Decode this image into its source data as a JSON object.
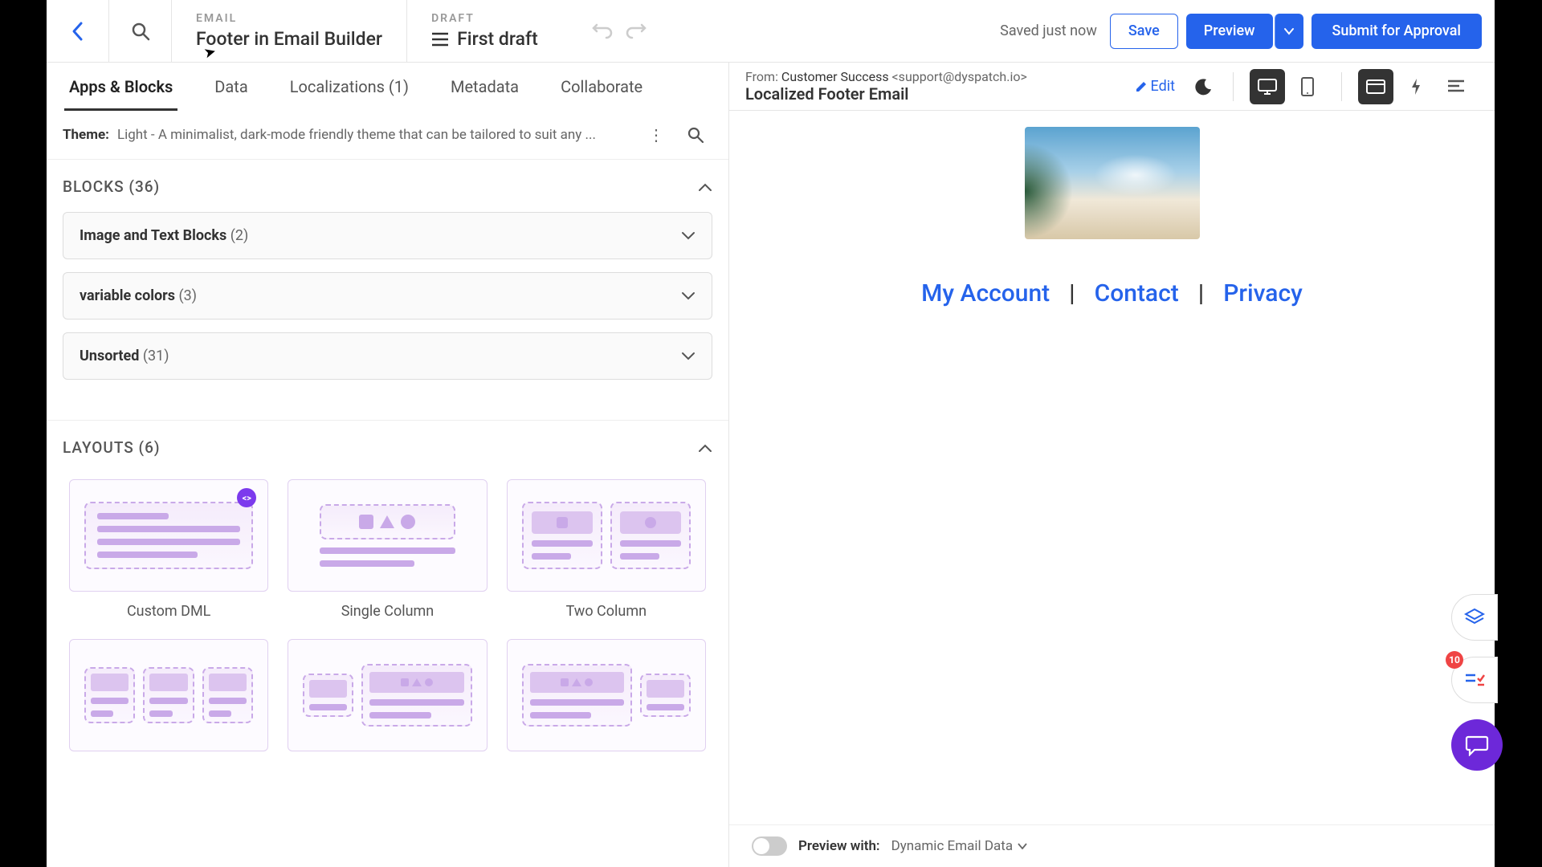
{
  "header": {
    "email_label": "EMAIL",
    "title": "Footer in Email Builder",
    "draft_label": "DRAFT",
    "draft_name": "First draft",
    "saved_text": "Saved just now",
    "save_btn": "Save",
    "preview_btn": "Preview",
    "submit_btn": "Submit for Approval"
  },
  "tabs": {
    "apps_blocks": "Apps & Blocks",
    "data": "Data",
    "localizations": "Localizations (1)",
    "metadata": "Metadata",
    "collaborate": "Collaborate"
  },
  "preview_header": {
    "from_label": "From:",
    "from_name": "Customer Success",
    "from_email": "<support@dyspatch.io>",
    "subject": "Localized Footer Email",
    "edit": "Edit"
  },
  "theme": {
    "label": "Theme:",
    "desc": "Light - A minimalist, dark-mode friendly theme that can be tailored to suit any ..."
  },
  "blocks": {
    "section_title": "BLOCKS (36)",
    "groups": [
      {
        "name": "Image and Text Blocks",
        "count": "(2)"
      },
      {
        "name": "variable colors",
        "count": "(3)"
      },
      {
        "name": "Unsorted",
        "count": "(31)"
      }
    ]
  },
  "layouts": {
    "section_title": "LAYOUTS (6)",
    "items": [
      "Custom DML",
      "Single Column",
      "Two Column"
    ]
  },
  "email": {
    "link_account": "My Account",
    "link_contact": "Contact",
    "link_privacy": "Privacy"
  },
  "preview_footer": {
    "label": "Preview with:",
    "value": "Dynamic Email Data"
  },
  "float": {
    "badge": "10"
  }
}
